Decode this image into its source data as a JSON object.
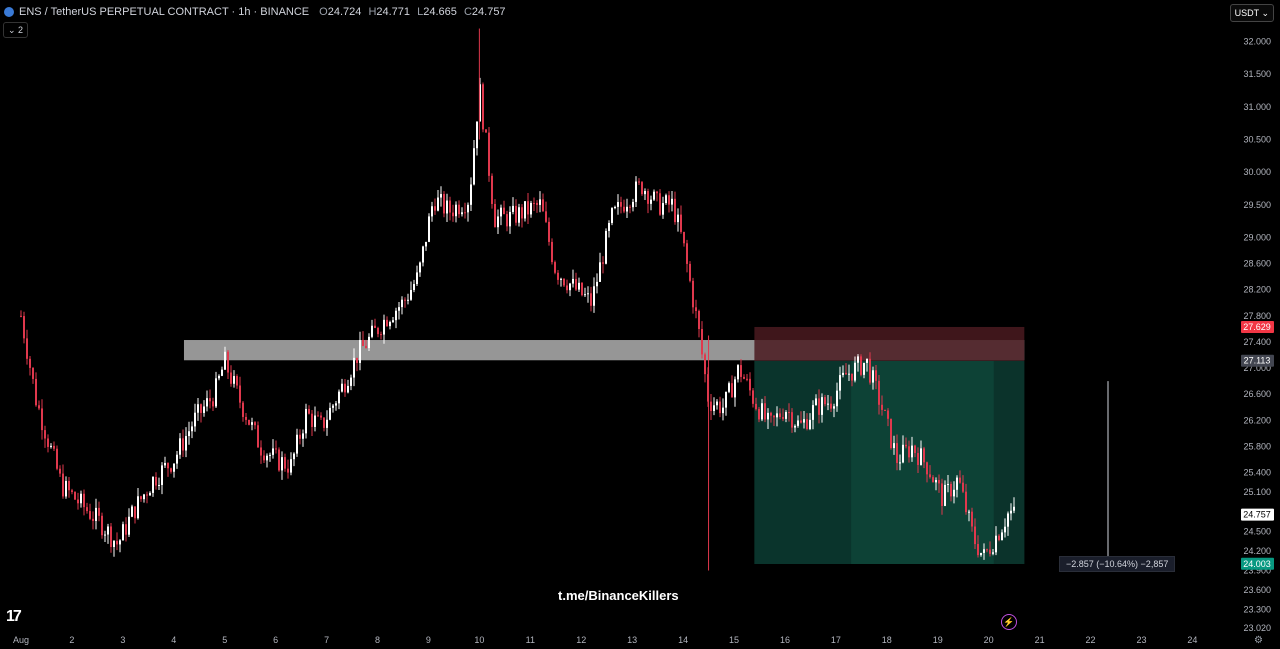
{
  "header": {
    "symbol_title": "ENS / TetherUS PERPETUAL CONTRACT · 1h · BINANCE",
    "open_label": "O",
    "open": "24.724",
    "high_label": "H",
    "high": "24.771",
    "low_label": "L",
    "low": "24.665",
    "close_label": "C",
    "close": "24.757",
    "indicator_toggle": "⌄ 2",
    "currency_button": "USDT ⌄"
  },
  "watermark": "t.me/BinanceKillers",
  "logo_text": "17",
  "measure_label": "−2.857 (−10.64%) −2,857",
  "icons": {
    "logo": "ens-logo-icon",
    "alert": "lightning-icon",
    "settings": "gear-icon"
  },
  "colors": {
    "up": "#ffffff",
    "down": "#e0384d",
    "zone": "#a0a0a0",
    "profit": "#0f4d3f",
    "loss": "#4a1a20",
    "last_price": "#ffffff"
  },
  "chart_data": {
    "type": "candlestick",
    "title": "ENS / TetherUS PERPETUAL CONTRACT · 1h · BINANCE",
    "x_ticks": [
      "Aug",
      "2",
      "3",
      "4",
      "5",
      "6",
      "7",
      "8",
      "9",
      "10",
      "11",
      "12",
      "13",
      "14",
      "15",
      "16",
      "17",
      "18",
      "19",
      "20",
      "21",
      "22",
      "23",
      "24"
    ],
    "y_ticks": [
      "32.000",
      "31.500",
      "31.000",
      "30.500",
      "30.000",
      "29.500",
      "29.000",
      "28.600",
      "28.200",
      "27.800",
      "27.400",
      "27.000",
      "26.600",
      "26.200",
      "25.800",
      "25.400",
      "25.100",
      "24.500",
      "24.200",
      "23.900",
      "23.600",
      "23.300",
      "23.020"
    ],
    "ylim": [
      23.02,
      32.3
    ],
    "price_labels": [
      {
        "value": 27.629,
        "text": "27.629",
        "color": "#f23645"
      },
      {
        "value": 27.113,
        "text": "27.113",
        "color": "#434651"
      },
      {
        "value": 24.757,
        "text": "24.757",
        "color": "#ffffff"
      },
      {
        "value": 24.003,
        "text": "24.003",
        "color": "#089981"
      }
    ],
    "close_path": [
      [
        "Aug",
        27.8
      ],
      [
        "1.3",
        26.5
      ],
      [
        "1.8",
        25.2
      ],
      [
        "2.2",
        24.9
      ],
      [
        "2.6",
        24.6
      ],
      [
        "2.9",
        24.3
      ],
      [
        "3.2",
        24.8
      ],
      [
        "3.6",
        25.3
      ],
      [
        "4.0",
        25.6
      ],
      [
        "4.4",
        26.2
      ],
      [
        "4.8",
        26.6
      ],
      [
        "5.0",
        27.1
      ],
      [
        "5.3",
        26.5
      ],
      [
        "5.7",
        25.8
      ],
      [
        "6.0",
        25.6
      ],
      [
        "6.3",
        25.5
      ],
      [
        "6.6",
        26.3
      ],
      [
        "6.9",
        26.1
      ],
      [
        "7.3",
        26.7
      ],
      [
        "7.6",
        27.2
      ],
      [
        "7.9",
        27.5
      ],
      [
        "8.2",
        27.8
      ],
      [
        "8.5",
        28.0
      ],
      [
        "8.8",
        28.4
      ],
      [
        "9.1",
        29.6
      ],
      [
        "9.4",
        29.4
      ],
      [
        "9.8",
        29.6
      ],
      [
        "10.0",
        31.3
      ],
      [
        "10.3",
        29.3
      ],
      [
        "10.6",
        29.3
      ],
      [
        "10.9",
        29.4
      ],
      [
        "11.2",
        29.5
      ],
      [
        "11.5",
        28.5
      ],
      [
        "11.9",
        28.2
      ],
      [
        "12.2",
        28.0
      ],
      [
        "12.6",
        29.3
      ],
      [
        "12.9",
        29.6
      ],
      [
        "13.2",
        29.8
      ],
      [
        "13.5",
        29.5
      ],
      [
        "13.8",
        29.5
      ],
      [
        "14.0",
        28.9
      ],
      [
        "14.3",
        27.6
      ],
      [
        "14.5",
        26.5
      ],
      [
        "14.8",
        26.4
      ],
      [
        "15.1",
        27.0
      ],
      [
        "15.4",
        26.5
      ],
      [
        "15.7",
        26.1
      ],
      [
        "16.0",
        26.4
      ],
      [
        "16.3",
        26.1
      ],
      [
        "16.6",
        26.4
      ],
      [
        "16.9",
        26.5
      ],
      [
        "17.2",
        26.9
      ],
      [
        "17.6",
        27.1
      ],
      [
        "17.9",
        26.4
      ],
      [
        "18.2",
        25.6
      ],
      [
        "18.5",
        25.8
      ],
      [
        "18.8",
        25.5
      ],
      [
        "19.1",
        25.0
      ],
      [
        "19.4",
        25.3
      ],
      [
        "19.7",
        24.4
      ],
      [
        "19.9",
        24.1
      ],
      [
        "20.2",
        24.5
      ],
      [
        "20.4",
        24.8
      ],
      [
        "20.5",
        24.76
      ]
    ],
    "zones": [
      {
        "name": "supply-zone",
        "y_top": 27.43,
        "y_bottom": 27.12,
        "x_start": "4.2",
        "x_end": "20.7"
      },
      {
        "name": "stop-zone",
        "y_top": 27.63,
        "y_bottom": 27.11,
        "x_start": "15.4",
        "x_end": "20.7"
      },
      {
        "name": "target-zone",
        "y_top": 27.11,
        "y_bottom": 24.0,
        "x_start": "15.4",
        "x_end": "20.7"
      }
    ]
  }
}
